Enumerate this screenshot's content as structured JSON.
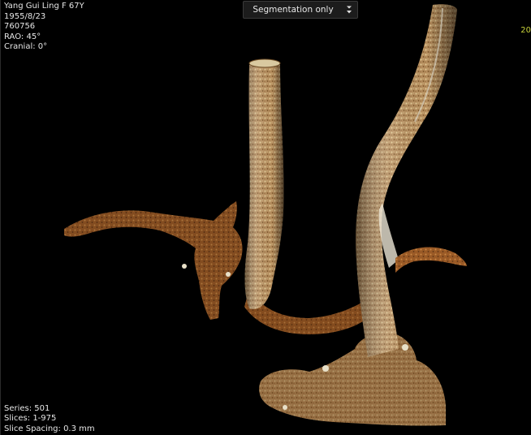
{
  "patient": {
    "name_line": "Yang Gui Ling  F  67Y",
    "dob": "1955/8/23",
    "id": "760756",
    "rao": "RAO: 45°",
    "cranial": "Cranial: 0°"
  },
  "view_mode": {
    "selected": "Segmentation only",
    "icon": "dropdown-caret-icon"
  },
  "corner_tr": "20",
  "series_info": {
    "series": "Series: 501",
    "slices": "Slices: 1-975",
    "spacing": "Slice Spacing: 0.3 mm"
  },
  "colors": {
    "background": "#000000",
    "vessel_tan": "#c9a46a",
    "vessel_bronze": "#a5622a",
    "overlay_text": "#e6e6e6",
    "accent_yellow": "#c8d23a"
  }
}
